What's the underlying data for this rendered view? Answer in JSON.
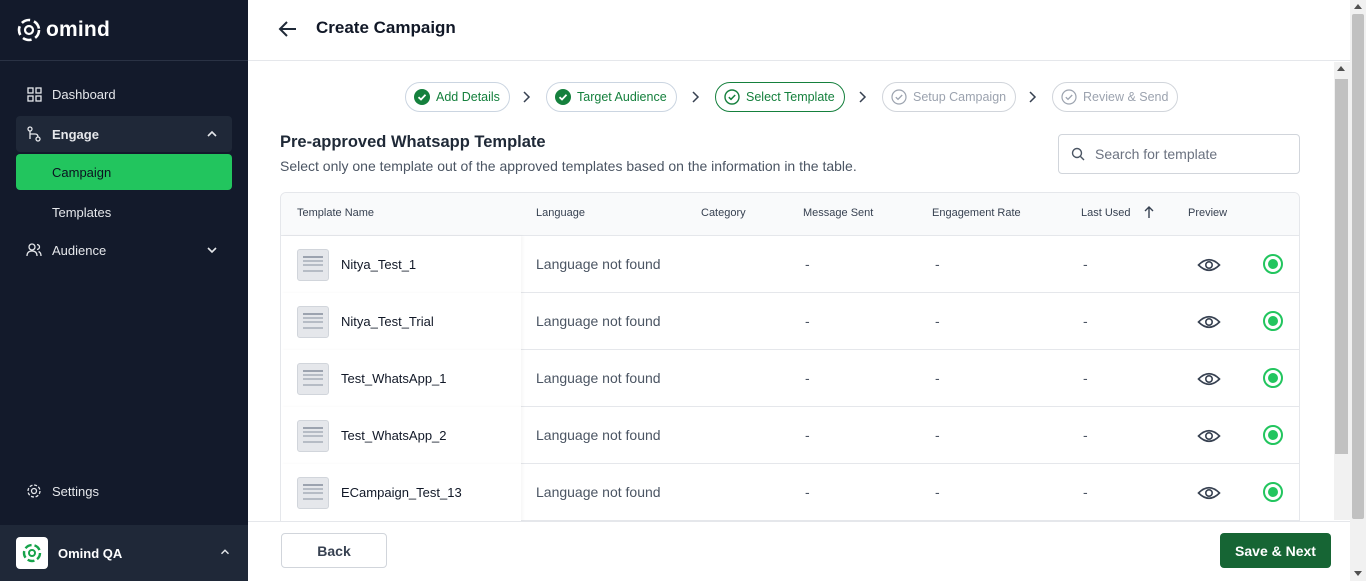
{
  "app": {
    "brand": "omind"
  },
  "sidebar": {
    "items": [
      {
        "label": "Dashboard",
        "icon": "grid-icon"
      },
      {
        "label": "Engage",
        "icon": "flow-icon"
      },
      {
        "label": "Campaign"
      },
      {
        "label": "Templates"
      },
      {
        "label": "Audience",
        "icon": "users-icon"
      }
    ],
    "settings_label": "Settings",
    "workspace_name": "Omind QA"
  },
  "header": {
    "title": "Create Campaign"
  },
  "stepper": {
    "steps": [
      {
        "label": "Add Details",
        "state": "done"
      },
      {
        "label": "Target Audience",
        "state": "done"
      },
      {
        "label": "Select Template",
        "state": "active"
      },
      {
        "label": "Setup Campaign",
        "state": "pending"
      },
      {
        "label": "Review & Send",
        "state": "pending"
      }
    ]
  },
  "section": {
    "title": "Pre-approved Whatsapp Template",
    "subtitle": "Select only one template out of the approved templates based on the information in the table."
  },
  "search": {
    "placeholder": "Search for template",
    "value": ""
  },
  "table": {
    "columns": [
      "Template Name",
      "Language",
      "Category",
      "Message Sent",
      "Engagement Rate",
      "Last Used",
      "Preview"
    ],
    "sort_column": "Last Used",
    "sort_direction": "ascending",
    "rows": [
      {
        "name": "Nitya_Test_1",
        "language": "Language not found",
        "category": "",
        "message_sent": "-",
        "engagement_rate": "-",
        "last_used": "-"
      },
      {
        "name": "Nitya_Test_Trial",
        "language": "Language not found",
        "category": "",
        "message_sent": "-",
        "engagement_rate": "-",
        "last_used": "-"
      },
      {
        "name": "Test_WhatsApp_1",
        "language": "Language not found",
        "category": "",
        "message_sent": "-",
        "engagement_rate": "-",
        "last_used": "-"
      },
      {
        "name": "Test_WhatsApp_2",
        "language": "Language not found",
        "category": "",
        "message_sent": "-",
        "engagement_rate": "-",
        "last_used": "-"
      },
      {
        "name": "ECampaign_Test_13",
        "language": "Language not found",
        "category": "",
        "message_sent": "-",
        "engagement_rate": "-",
        "last_used": "-"
      }
    ]
  },
  "footer": {
    "back_label": "Back",
    "next_label": "Save & Next"
  },
  "colors": {
    "sidebar_bg": "#131a2b",
    "accent_green": "#22c55e",
    "primary_button": "#166534",
    "step_green": "#15803d"
  }
}
